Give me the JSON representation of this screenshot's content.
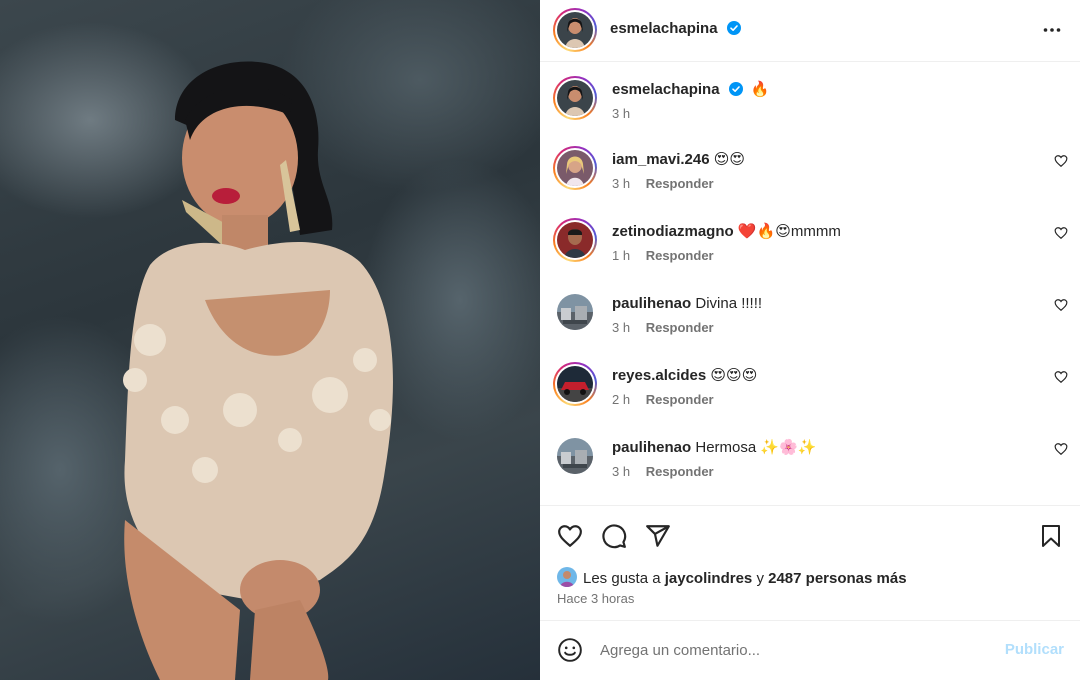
{
  "post": {
    "author": "esmelachapina",
    "caption_emoji": "🔥",
    "caption_time": "3 h"
  },
  "comments": [
    {
      "user": "iam_mavi.246",
      "text": "😍😍",
      "time": "3 h",
      "reply": "Responder",
      "story_ring": true
    },
    {
      "user": "zetinodiazmagno",
      "text": "❤️🔥😍mmmm",
      "time": "1 h",
      "reply": "Responder",
      "story_ring": true
    },
    {
      "user": "paulihenao",
      "text": "Divina !!!!!",
      "time": "3 h",
      "reply": "Responder",
      "story_ring": false
    },
    {
      "user": "reyes.alcides",
      "text": "😍😍😍",
      "time": "2 h",
      "reply": "Responder",
      "story_ring": true
    },
    {
      "user": "paulihenao",
      "text": "Hermosa ✨🌸✨",
      "time": "3 h",
      "reply": "Responder",
      "story_ring": false
    }
  ],
  "likes": {
    "prefix": "Les gusta a",
    "user": "jaycolindres",
    "connector": "y",
    "others": "2487 personas más"
  },
  "time_ago": "Hace 3 horas",
  "composer": {
    "placeholder": "Agrega un comentario...",
    "publish_label": "Publicar"
  },
  "icons": {
    "verified": "verified-badge-icon",
    "more": "more-options-icon",
    "like": "heart-icon",
    "comment": "comment-icon",
    "share": "share-icon",
    "save": "bookmark-icon",
    "emoji": "emoji-icon"
  },
  "colors": {
    "verified": "#0095f6",
    "publish_disabled": "#b2dffc",
    "secondary_text": "#737373"
  }
}
